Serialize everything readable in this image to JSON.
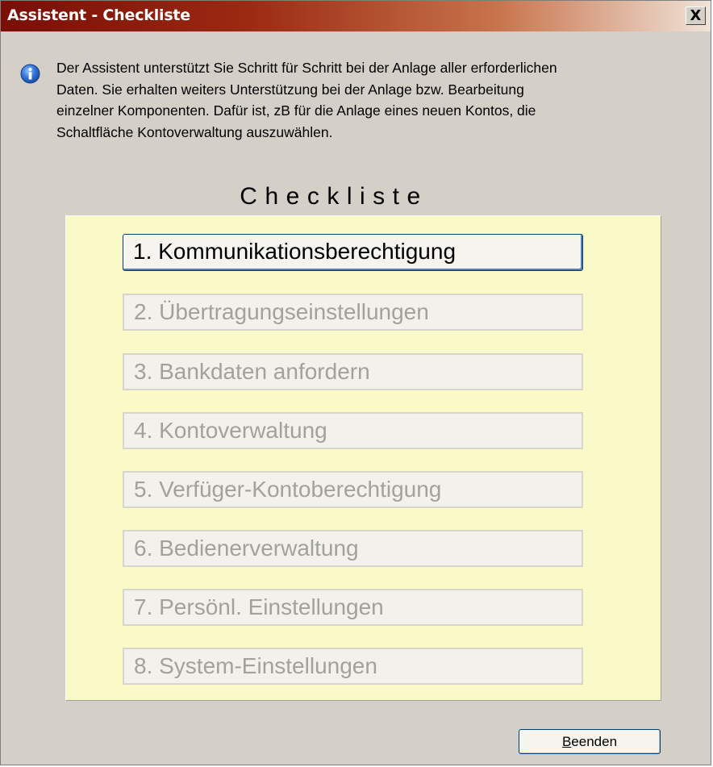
{
  "window": {
    "title": "Assistent - Checkliste",
    "close_label": "X"
  },
  "info": {
    "icon": "info-icon",
    "lines": [
      "Der Assistent unterstützt Sie Schritt für Schritt bei der Anlage aller erforderlichen",
      "Daten. Sie erhalten weiters Unterstützung bei der Anlage bzw. Bearbeitung",
      "einzelner Komponenten. Dafür ist, zB für die Anlage eines neuen Kontos, die",
      "Schaltfläche Kontoverwaltung auszuwählen."
    ]
  },
  "checklist": {
    "title": "Checkliste",
    "steps": [
      {
        "label": "1. Kommunikationsberechtigung",
        "enabled": true
      },
      {
        "label": "2. Übertragungseinstellungen",
        "enabled": false
      },
      {
        "label": "3. Bankdaten anfordern",
        "enabled": false
      },
      {
        "label": "4. Kontoverwaltung",
        "enabled": false
      },
      {
        "label": "5. Verfüger-Kontoberechtigung",
        "enabled": false
      },
      {
        "label": "6. Bedienerverwaltung",
        "enabled": false
      },
      {
        "label": "7. Persönl. Einstellungen",
        "enabled": false
      },
      {
        "label": "8. System-Einstellungen",
        "enabled": false
      }
    ]
  },
  "footer": {
    "end_button_mnemonic": "B",
    "end_button_rest": "eenden"
  },
  "colors": {
    "panel_background": "#fafac8",
    "window_background": "#d4d0c8",
    "titlebar_start": "#7a0e06",
    "disabled_text": "#a2a29a"
  }
}
